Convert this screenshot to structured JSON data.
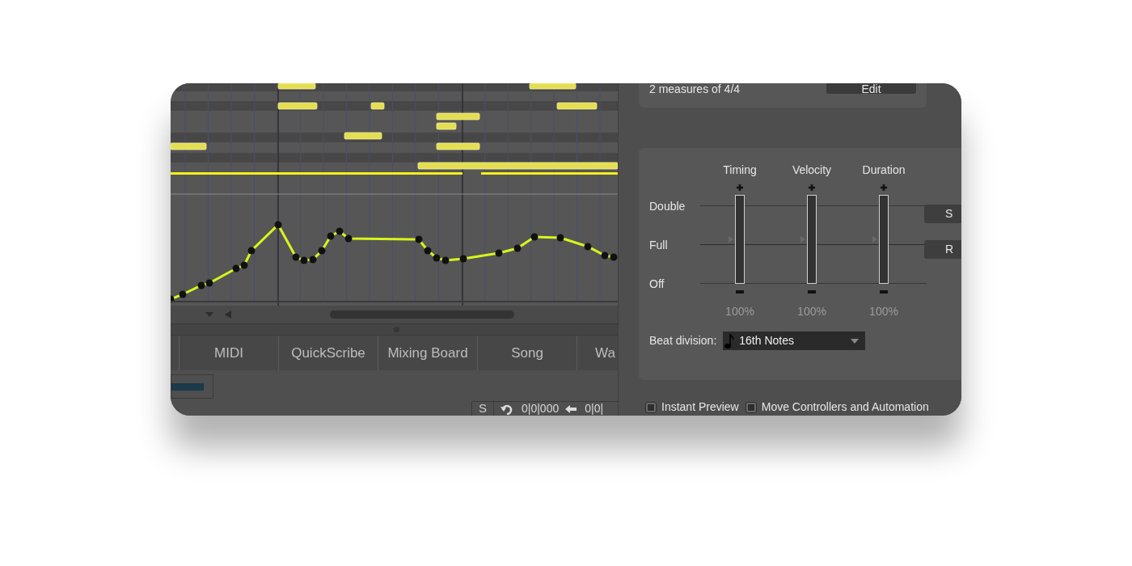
{
  "tabs": [
    {
      "label": "MIDI"
    },
    {
      "label": "QuickScribe"
    },
    {
      "label": "Mixing Board"
    },
    {
      "label": "Song"
    },
    {
      "label": "Wa"
    }
  ],
  "transport": {
    "solo": "S",
    "position": "0|0|000",
    "position_2": "0|0|"
  },
  "style_card": {
    "summary": "2 measures of 4/4",
    "edit_button": "Edit"
  },
  "groove": {
    "rows": [
      "Double",
      "Full",
      "Off"
    ],
    "sliders": [
      {
        "label": "Timing",
        "level": 0.5,
        "reading": "100%"
      },
      {
        "label": "Velocity",
        "level": 0.5,
        "reading": "100%"
      },
      {
        "label": "Duration",
        "level": 0.5,
        "reading": "100%"
      }
    ],
    "side_buttons": [
      "S",
      "R"
    ],
    "beat_division": {
      "label": "Beat division:",
      "value": "16th Notes"
    }
  },
  "options": [
    {
      "label": "Instant Preview",
      "checked": false
    },
    {
      "label": "Move Controllers and Automation",
      "checked": false
    }
  ]
}
